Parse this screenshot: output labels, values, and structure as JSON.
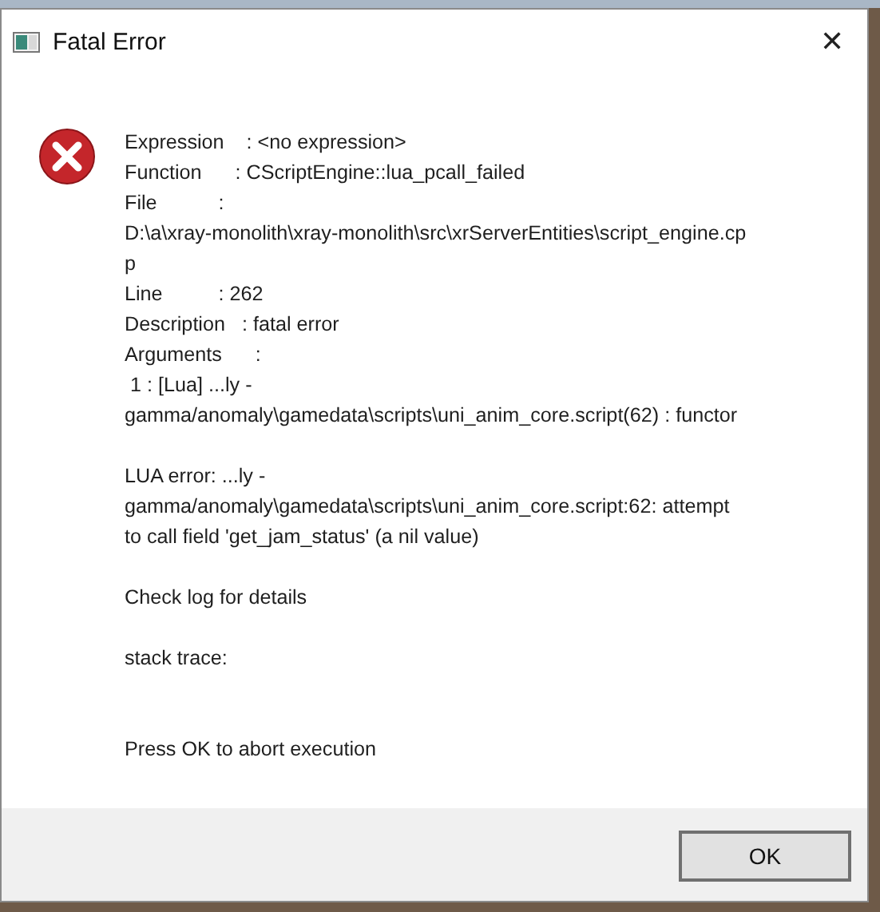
{
  "window": {
    "title": "Fatal Error",
    "close": "✕"
  },
  "message": {
    "kind": "error",
    "paragraphs": [
      {
        "kind": "text",
        "lines": [
          "Expression    : <no expression>",
          "Function      : CScriptEngine::lua_pcall_failed",
          "File           :",
          "D:\\a\\xray-monolith\\xray-monolith\\src\\xrServerEntities\\script_engine.cp",
          "p",
          "Line          : 262",
          "Description   : fatal error",
          "Arguments      :",
          " 1 : [Lua] ...ly -",
          "gamma/anomaly\\gamedata\\scripts\\uni_anim_core.script(62) : functor"
        ]
      },
      {
        "kind": "text",
        "lines": [
          "LUA error: ...ly -",
          "gamma/anomaly\\gamedata\\scripts\\uni_anim_core.script:62: attempt",
          "to call field 'get_jam_status' (a nil value)"
        ]
      },
      {
        "kind": "text",
        "lines": [
          "Check log for details"
        ]
      },
      {
        "kind": "text",
        "lines": [
          "stack trace:"
        ]
      },
      {
        "kind": "prompt",
        "lines": [
          "Press OK to abort execution"
        ]
      }
    ]
  },
  "buttons": [
    {
      "label": "OK",
      "default": true
    }
  ]
}
